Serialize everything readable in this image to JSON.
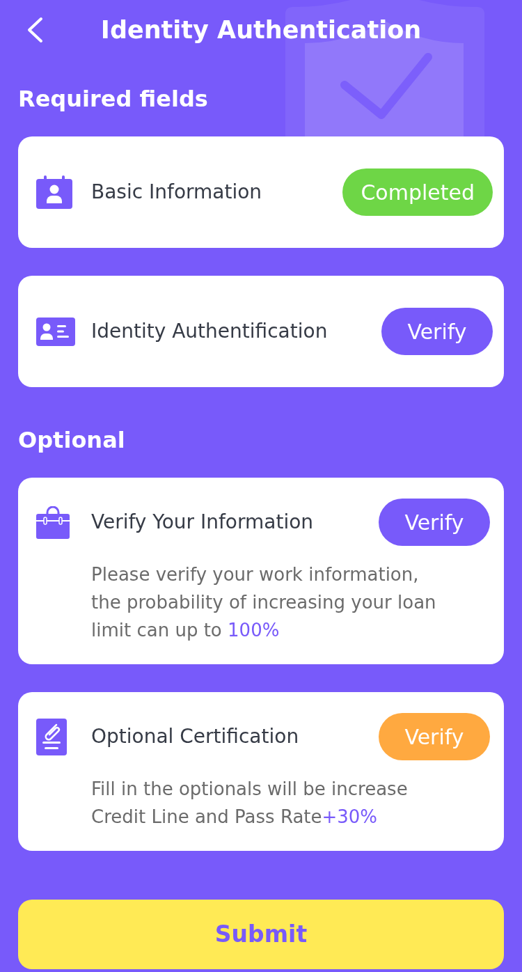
{
  "header": {
    "title": "Identity Authentication"
  },
  "sections": [
    {
      "title": "Required fields",
      "items": [
        {
          "title": "Basic Information",
          "action": {
            "label": "Completed",
            "color": "#6ed646"
          }
        },
        {
          "title": "Identity Authentification",
          "action": {
            "label": "Verify",
            "color": "#785afa"
          }
        }
      ]
    },
    {
      "title": "Optional",
      "items": [
        {
          "title": "Verify Your Information",
          "description": "Please verify your work information, the probability of increasing your loan limit can up to ",
          "highlight": "100%",
          "action": {
            "label": "Verify",
            "color": "#785afa"
          }
        },
        {
          "title": "Optional Certification",
          "description": "Fill in the optionals will be increase Credit Line and Pass Rate",
          "highlight": "+30%",
          "action": {
            "label": "Verify",
            "color": "#ffa940"
          }
        }
      ]
    }
  ],
  "submit": {
    "label": "Submit"
  }
}
